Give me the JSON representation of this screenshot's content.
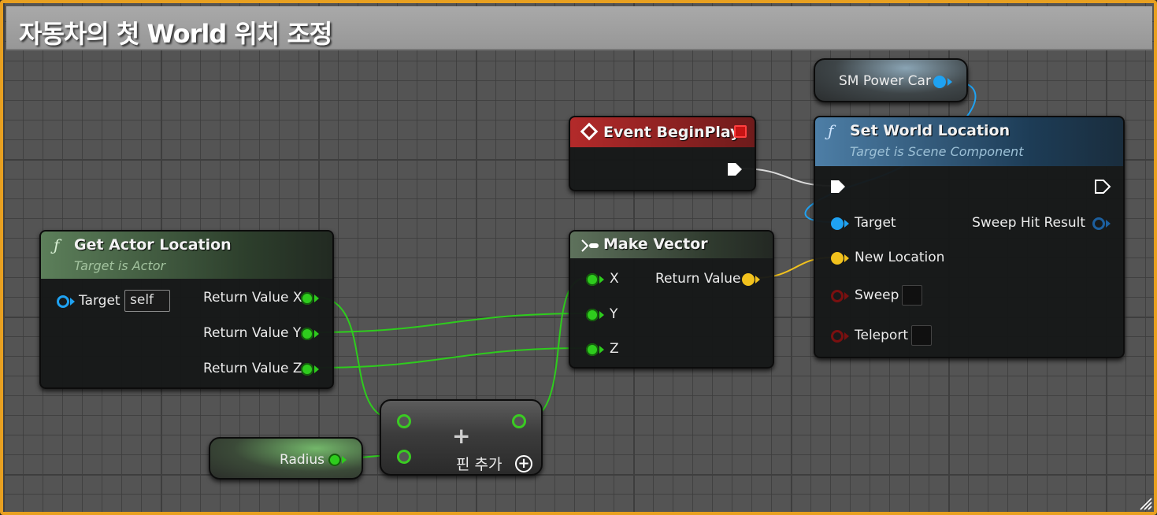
{
  "comment": {
    "title": "자동차의 첫 World 위치 조정"
  },
  "sm_power_car": {
    "label": "SM Power Car"
  },
  "event_begin_play": {
    "title": "Event BeginPlay"
  },
  "set_world_location": {
    "title": "Set World Location",
    "subtitle": "Target is Scene Component",
    "pins": {
      "target": "Target",
      "sweep_hit_result": "Sweep Hit Result",
      "new_location": "New Location",
      "sweep": "Sweep",
      "teleport": "Teleport"
    }
  },
  "get_actor_location": {
    "title": "Get Actor Location",
    "subtitle": "Target is Actor",
    "pins": {
      "target": "Target",
      "target_value": "self",
      "x": "Return Value X",
      "y": "Return Value Y",
      "z": "Return Value Z"
    }
  },
  "make_vector": {
    "title": "Make Vector",
    "pins": {
      "x": "X",
      "y": "Y",
      "z": "Z",
      "return_value": "Return Value"
    }
  },
  "add_node": {
    "symbol": "+",
    "add_pin_label": "핀 추가"
  },
  "radius": {
    "label": "Radius"
  },
  "colors": {
    "comment_border": "#e8a020",
    "float_pin": "#2ecc1d",
    "vector_pin": "#f2c21d",
    "object_pin": "#1fa2f2",
    "event_header": "#8e1c1c"
  }
}
